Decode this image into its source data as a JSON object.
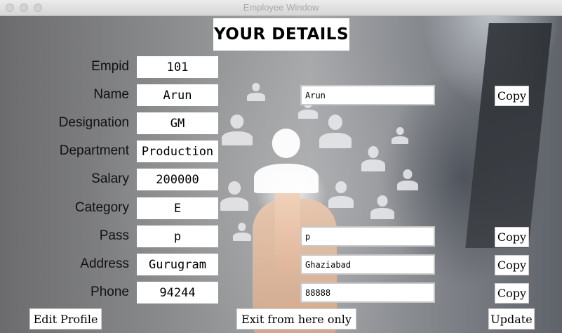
{
  "window": {
    "title": "Employee Window"
  },
  "header": {
    "title": "YOUR DETAILS"
  },
  "fields": [
    {
      "label": "Empid",
      "value": "101"
    },
    {
      "label": "Name",
      "value": "Arun",
      "edit": "Arun",
      "copy": "Copy"
    },
    {
      "label": "Designation",
      "value": "GM"
    },
    {
      "label": "Department",
      "value": "Production"
    },
    {
      "label": "Salary",
      "value": "200000"
    },
    {
      "label": "Category",
      "value": "E"
    },
    {
      "label": "Pass",
      "value": "p",
      "edit": "p",
      "copy": "Copy"
    },
    {
      "label": "Address",
      "value": "Gurugram",
      "edit": "Ghaziabad",
      "copy": "Copy"
    },
    {
      "label": "Phone",
      "value": "94244",
      "edit": "88888",
      "copy": "Copy"
    }
  ],
  "actions": {
    "edit_profile": "Edit Profile",
    "exit": "Exit from here only",
    "update": "Update"
  }
}
